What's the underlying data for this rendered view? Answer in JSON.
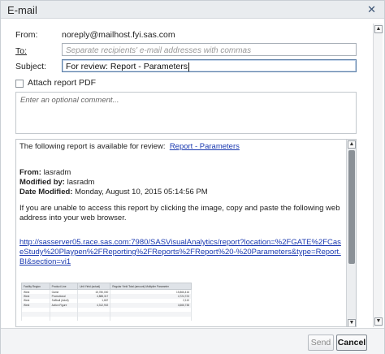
{
  "dialog": {
    "title": "E-mail"
  },
  "from": {
    "label": "From:",
    "value": "noreply@mailhost.fyi.sas.com"
  },
  "to": {
    "label": "To:",
    "placeholder": "Separate recipients' e-mail addresses with commas"
  },
  "subject": {
    "label": "Subject:",
    "value": "For review: Report - Parameters"
  },
  "attach": {
    "label": "Attach report PDF",
    "checked": false
  },
  "comment": {
    "placeholder": "Enter an optional comment..."
  },
  "preview": {
    "intro": "The following report is available for review:",
    "report_link": "Report - Parameters",
    "from_label": "From:",
    "from_value": "lasradm",
    "modified_by_label": "Modified by:",
    "modified_by_value": "lasradm",
    "date_label": "Date Modified:",
    "date_value": "Monday, August 10, 2015 05:14:56 PM",
    "instructions": "If you are unable to access this report by clicking the image, copy and paste the following web address into your web browser.",
    "url": "http://sasserver05.race.sas.com:7980/SASVisualAnalytics/report?location=%2FGATE%2FCaseStudy%20Playpen%2FReporting%2FReports%2FReport%20-%20Parameters&type=Report.BI&section=vi1",
    "thumbnail": {
      "headers": [
        "Facility Region",
        "Product Line",
        "Unit Yield (actual)",
        "Regular Yield Total (amount) Multiplier Parameter"
      ],
      "rows": [
        [
          "West",
          "Game",
          "15,780,000",
          "15,866,416"
        ],
        [
          "West",
          "Promotional",
          "4,888,317",
          "4,724,723"
        ],
        [
          "West",
          "Softball (Adult)",
          "1,667",
          "2,110"
        ],
        [
          "West",
          "Action Figure",
          "4,312,902",
          "4,666,738"
        ]
      ]
    }
  },
  "buttons": {
    "send": "Send",
    "cancel": "Cancel"
  },
  "icons": {
    "close": "close-icon",
    "scroll_up": "scroll-up-arrow-icon",
    "scroll_down": "scroll-down-arrow-icon"
  },
  "colors": {
    "link": "#1a39b0",
    "title_bar": "#e9ecef",
    "focus_border": "#5b7ea6"
  }
}
